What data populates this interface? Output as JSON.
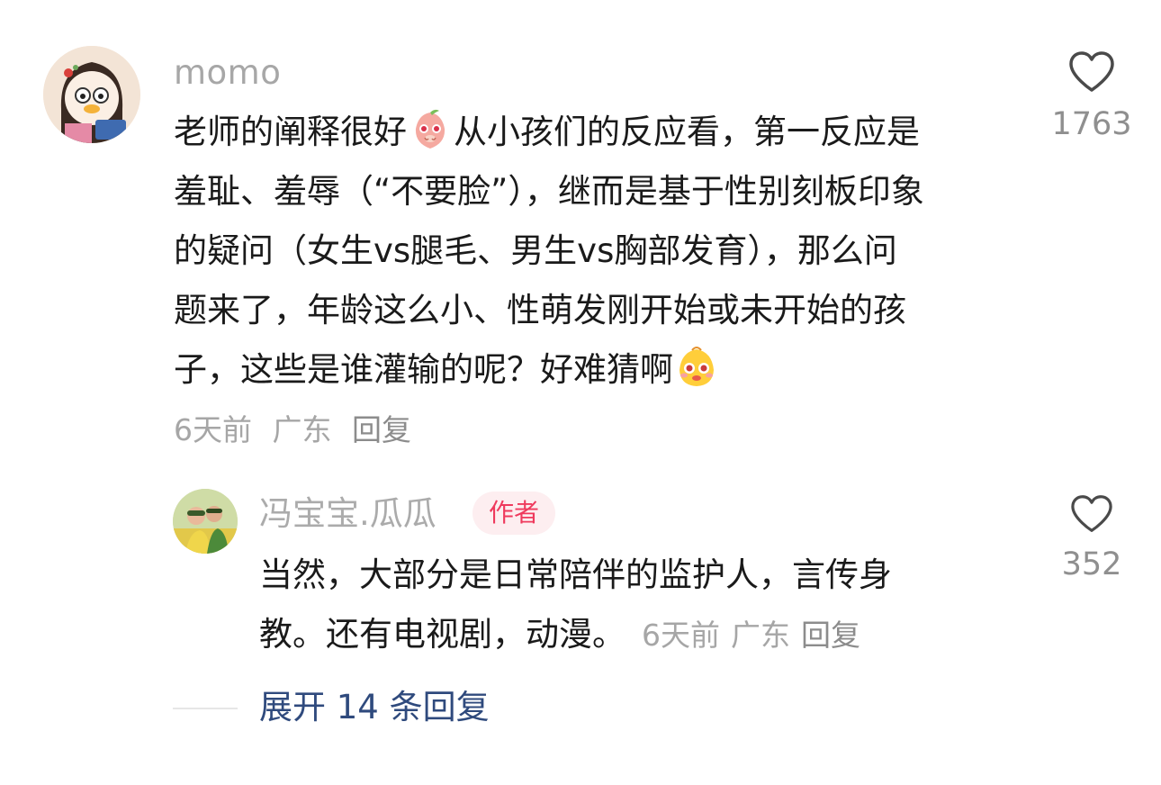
{
  "comment": {
    "username": "momo",
    "lines": [
      [
        "老师的阐释很好",
        "从小孩们的反应看，第一反应是"
      ],
      "羞耻、羞辱（“不要脸”），继而是基于性别刻板印象",
      "的疑问（女生vs腿毛、男生vs胸部发育），那么问",
      "题来了，年龄这么小、性萌发刚开始或未开始的孩",
      [
        "子，这些是谁灌输的呢？好难猜啊",
        ""
      ]
    ],
    "emojis": [
      "blushing-peach-emoji",
      "teary-face-emoji"
    ],
    "time": "6天前",
    "location": "广东",
    "reply_label": "回复",
    "like_count": "1763",
    "like_icon": "heart-outline-icon"
  },
  "reply": {
    "username": "冯宝宝.瓜瓜",
    "badge": "作者",
    "line1": "当然，大部分是日常陪伴的监护人，言传身",
    "line2": "教。还有电视剧，动漫。",
    "time": "6天前",
    "location": "广东",
    "reply_label": "回复",
    "like_count": "352",
    "like_icon": "heart-outline-icon"
  },
  "expand": {
    "label": "展开 14 条回复"
  },
  "colors": {
    "text": "#1a1a1a",
    "meta": "#a6a6a6",
    "badge_text": "#ef3a5d",
    "badge_bg": "#fdeef0",
    "expand_link": "#2f4a7d"
  }
}
